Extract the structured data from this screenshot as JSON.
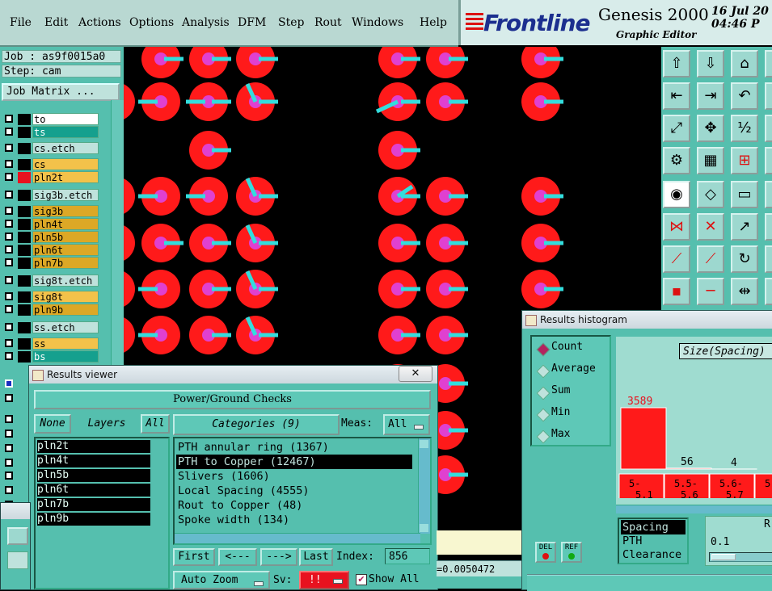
{
  "menu": {
    "items": [
      "File",
      "Edit",
      "Actions",
      "Options",
      "Analysis",
      "DFM",
      "Step",
      "Rout",
      "Windows",
      "Help"
    ]
  },
  "brand": {
    "logo": "Frontline",
    "product": "Genesis 2000",
    "subtitle": "Graphic Editor",
    "date": "16 Jul 20",
    "time": "04:46 P"
  },
  "job": {
    "job_label": "Job : as9f0015a0",
    "step_label": "Step: cam",
    "matrix_button": "Job Matrix ..."
  },
  "layers": [
    {
      "name": "to",
      "fill": "#ffffff",
      "cb": "#ffffff",
      "sw": "#000000"
    },
    {
      "name": "ts",
      "fill": "#15a08e",
      "cb": "#ffffff",
      "sw": "#000000",
      "text": "#fff"
    },
    {
      "name": "cs.etch",
      "fill": "#bfe2dc",
      "cb": "#ffffff",
      "sw": "#000000"
    },
    {
      "name": "cs",
      "fill": "#f3c24a",
      "cb": "#ffffff",
      "sw": "#000000"
    },
    {
      "name": "pln2t",
      "fill": "#f3c24a",
      "cb": "#ffffff",
      "sw": "#e8121f"
    },
    {
      "name": "sig3b.etch",
      "fill": "#bfe2dc",
      "cb": "#ffffff",
      "sw": "#000000"
    },
    {
      "name": "sig3b",
      "fill": "#dca826",
      "cb": "#ffffff",
      "sw": "#000000"
    },
    {
      "name": "pln4t",
      "fill": "#dca826",
      "cb": "#ffffff",
      "sw": "#000000"
    },
    {
      "name": "pln5b",
      "fill": "#dca826",
      "cb": "#ffffff",
      "sw": "#000000"
    },
    {
      "name": "pln6t",
      "fill": "#dca826",
      "cb": "#ffffff",
      "sw": "#000000"
    },
    {
      "name": "pln7b",
      "fill": "#dca826",
      "cb": "#ffffff",
      "sw": "#000000"
    },
    {
      "name": "sig8t.etch",
      "fill": "#bfe2dc",
      "cb": "#ffffff",
      "sw": "#000000"
    },
    {
      "name": "sig8t",
      "fill": "#f3c24a",
      "cb": "#ffffff",
      "sw": "#000000"
    },
    {
      "name": "pln9b",
      "fill": "#dca826",
      "cb": "#ffffff",
      "sw": "#000000"
    },
    {
      "name": "ss.etch",
      "fill": "#bfe2dc",
      "cb": "#ffffff",
      "sw": "#000000"
    },
    {
      "name": "ss",
      "fill": "#f3c24a",
      "cb": "#ffffff",
      "sw": "#000000"
    },
    {
      "name": "bs",
      "fill": "#15a08e",
      "cb": "#ffffff",
      "sw": "#000000",
      "text": "#fff"
    }
  ],
  "results_viewer": {
    "title": "Results viewer",
    "close": "✕",
    "header": "Power/Ground Checks",
    "none_btn": "None",
    "layers_label": "Layers",
    "all_btn": "All",
    "layer_items": [
      "pln2t",
      "pln4t",
      "pln5b",
      "pln6t",
      "pln7b",
      "pln9b"
    ],
    "categories_label": "Categories (9)",
    "meas_label": "Meas:",
    "meas_value": "All",
    "categories": [
      "PTH annular ring (1367)",
      "PTH to Copper (12467)",
      "Slivers (1606)",
      "Local Spacing (4555)",
      "Rout to Copper (48)",
      "Spoke width (134)"
    ],
    "selected_category": 1,
    "first_btn": "First",
    "prev_btn": "<---",
    "next_btn": "--->",
    "last_btn": "Last",
    "index_label": "Index:",
    "index_value": "856",
    "auto_zoom": "Auto Zoom",
    "sv_label": "Sv:",
    "sv_value": "!!",
    "show_all": "Show All"
  },
  "status": {
    "readout": "=0.0050472"
  },
  "histogram": {
    "title": "Results histogram",
    "options": [
      "Count",
      "Average",
      "Sum",
      "Min",
      "Max"
    ],
    "selected_option": 0,
    "size_label": "Size(Spacing)",
    "bins": [
      "5-\n5.1",
      "5.5-\n5.6",
      "5.6-\n5.7",
      "5."
    ],
    "del_btn": "DEL",
    "ref_btn": "REF",
    "measure_items": [
      "Spacing",
      "PTH",
      "Clearance"
    ],
    "value": "0.1",
    "r_label": "R"
  },
  "chart_data": {
    "type": "bar",
    "categories": [
      "5-5.1",
      "5.5-5.6",
      "5.6-5.7"
    ],
    "values": [
      3589,
      56,
      4
    ],
    "data_labels": [
      "3589",
      "56",
      "4"
    ]
  },
  "colors": {
    "pad": "#ff1a1a",
    "hole": "#e040d0",
    "spoke": "#33dddd",
    "panel": "#55bfae"
  }
}
